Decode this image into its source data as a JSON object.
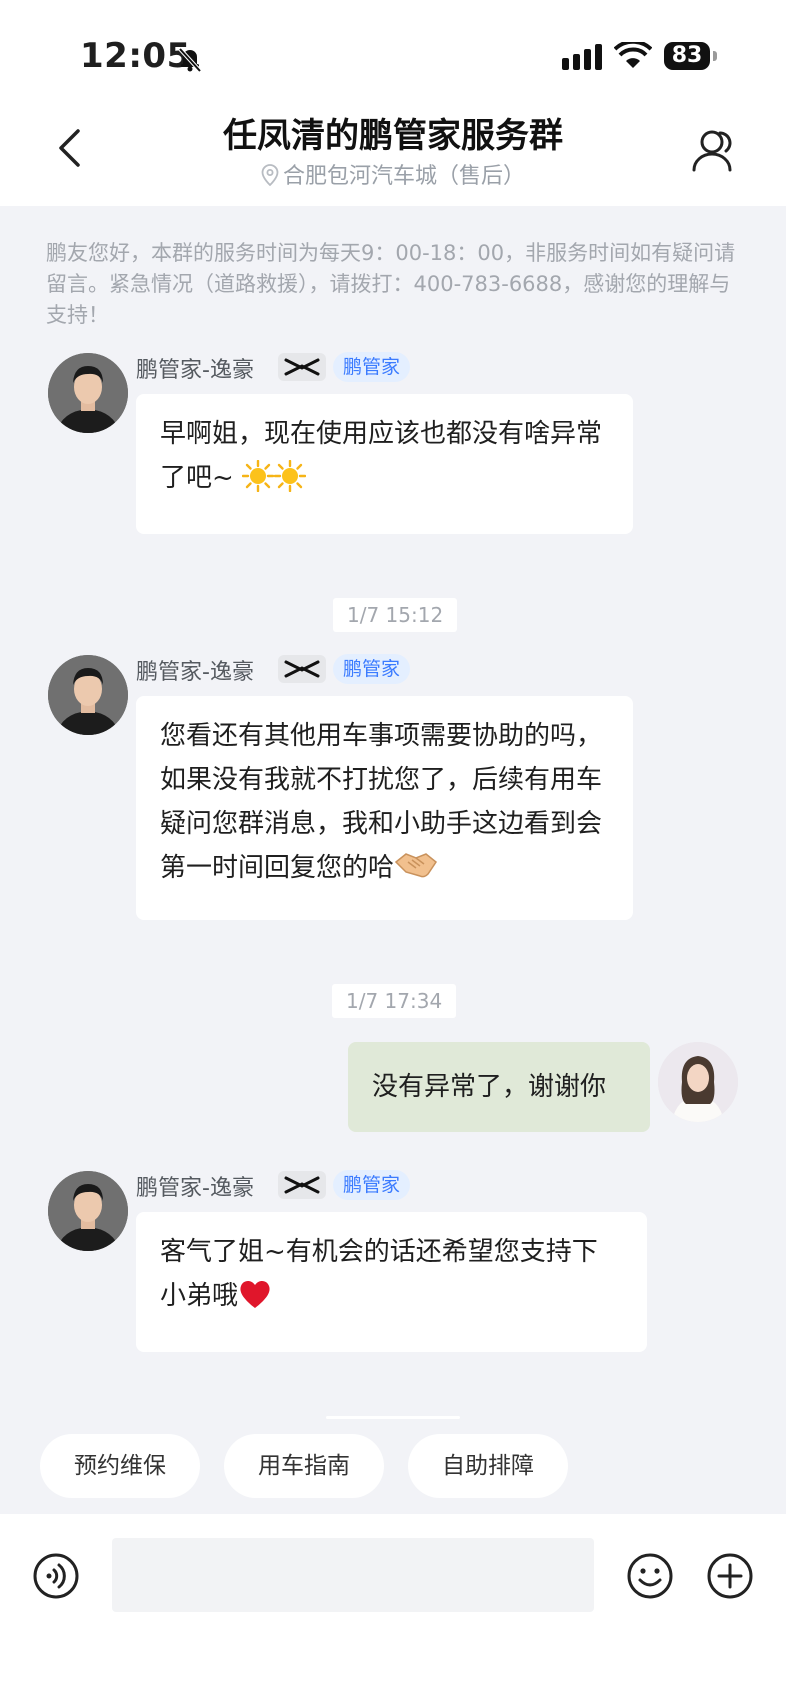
{
  "status_bar": {
    "time": "12:05",
    "battery": "83"
  },
  "header": {
    "title": "任凤清的鹏管家服务群",
    "location": "合肥包河汽车城（售后）"
  },
  "notice": "鹏友您好，本群的服务时间为每天9：00-18：00，非服务时间如有疑问请留言。紧急情况（道路救援），请拨打：400-783-6688，感谢您的理解与支持！",
  "messages": [
    {
      "sender": "鹏管家-逸豪",
      "role": "鹏管家",
      "text": "早啊姐，现在使用应该也都没有啥异常了吧~",
      "emoji": "sun-emoji ×2"
    },
    {
      "timestamp": "1/7 15:12"
    },
    {
      "sender": "鹏管家-逸豪",
      "role": "鹏管家",
      "text": "您看还有其他用车事项需要协助的吗，如果没有我就不打扰您了，后续有用车疑问您群消息，我和小助手这边看到会第一时间回复您的哈",
      "emoji": "handshake-emoji"
    },
    {
      "timestamp": "1/7 17:34"
    },
    {
      "sender": "me",
      "text": "没有异常了，谢谢你"
    },
    {
      "sender": "鹏管家-逸豪",
      "role": "鹏管家",
      "text": "客气了姐~有机会的话还希望您支持下小弟哦",
      "emoji": "heart-emoji"
    }
  ],
  "quick_actions": [
    "预约维保",
    "用车指南",
    "自助排障"
  ],
  "input": {
    "placeholder": ""
  },
  "colors": {
    "brand_blue": "#3b7bff",
    "my_bubble": "#e0e9d8",
    "background": "#f2f3f7"
  }
}
